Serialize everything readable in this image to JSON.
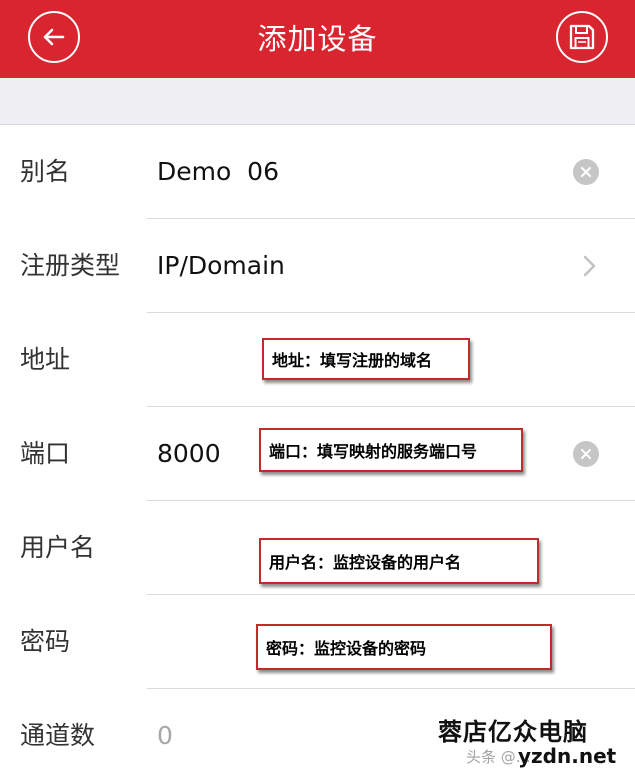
{
  "header": {
    "title": "添加设备",
    "back_icon": "back-arrow-circle-icon",
    "save_icon": "save-disk-circle-icon",
    "color": "#d9252f"
  },
  "form": {
    "rows": [
      {
        "label": "别名",
        "value": "Demo  06"
      },
      {
        "label": "注册类型",
        "value": "IP/Domain"
      },
      {
        "label": "地址",
        "value": ""
      },
      {
        "label": "端口",
        "value": "8000"
      },
      {
        "label": "用户名",
        "value": ""
      },
      {
        "label": "密码",
        "value": ""
      },
      {
        "label": "通道数",
        "value": "0"
      }
    ]
  },
  "annotations": {
    "address": "地址：填写注册的域名",
    "port": "端口：填写映射的服务端口号",
    "username": "用户名：监控设备的用户名",
    "password": "密码：监控设备的密码"
  },
  "watermark": {
    "title": "蓉店亿众电脑",
    "sub": "头条 @…",
    "url": "yzdn.net"
  }
}
